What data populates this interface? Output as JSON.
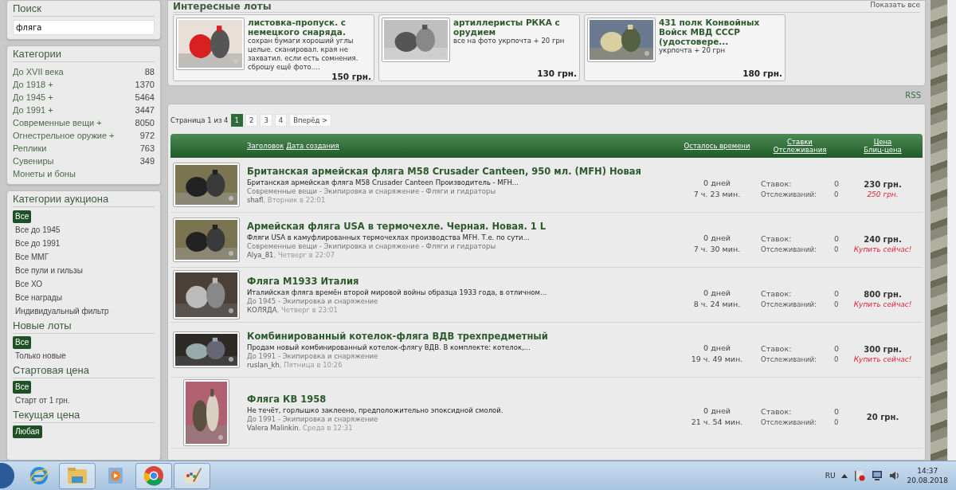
{
  "search": {
    "title": "Поиск",
    "value": "фляга"
  },
  "categories": {
    "title": "Категории",
    "items": [
      {
        "label": "До XVII века",
        "count": "88"
      },
      {
        "label": "До 1918 +",
        "count": "1370"
      },
      {
        "label": "До 1945 +",
        "count": "5464"
      },
      {
        "label": "До 1991 +",
        "count": "3447"
      },
      {
        "label": "Современные вещи +",
        "count": "8050"
      },
      {
        "label": "Огнестрельное оружие +",
        "count": "972"
      },
      {
        "label": "Реплики",
        "count": "763"
      },
      {
        "label": "Сувениры",
        "count": "349"
      },
      {
        "label": "Монеты и боны"
      }
    ]
  },
  "filters": [
    {
      "title": "Категории аукциона",
      "options": [
        {
          "label": "Все",
          "selected": true
        },
        {
          "label": "Все до 1945",
          "selected": false
        },
        {
          "label": "Все до 1991",
          "selected": false
        },
        {
          "label": "Все ММГ",
          "selected": false
        },
        {
          "label": "Все пули и гильзы",
          "selected": false
        },
        {
          "label": "Все ХО",
          "selected": false
        },
        {
          "label": "Все награды",
          "selected": false
        },
        {
          "label": "Индивидуальный фильтр",
          "selected": false
        }
      ]
    },
    {
      "title": "Новые лоты",
      "options": [
        {
          "label": "Все",
          "selected": true
        },
        {
          "label": "Только новые",
          "selected": false
        }
      ]
    },
    {
      "title": "Стартовая цена",
      "options": [
        {
          "label": "Все",
          "selected": true
        },
        {
          "label": "Старт от 1 грн.",
          "selected": false
        }
      ]
    },
    {
      "title": "Текущая цена",
      "options": [
        {
          "label": "Любая",
          "selected": true
        }
      ]
    }
  ],
  "interesting": {
    "title": "Интересные лоты",
    "show_all": "Показать все",
    "cards": [
      {
        "title": "листовка-пропуск. с немецкого снаряда.",
        "text": "сохран бумаги хороший углы целые. сканировал. края не захватил. если есть сомнения. сброшу ещё фото....",
        "price": "150 грн."
      },
      {
        "title": "артиллеристы РККА с орудием",
        "text": "все на фото укрпочта + 20 грн",
        "price": "130 грн."
      },
      {
        "title": "431 полк Конвойных Войск МВД СССР (удостовере...",
        "text": "укрпочта + 20 грн",
        "price": "180 грн."
      }
    ]
  },
  "rss": "RSS",
  "pagination": {
    "label": "Страница 1 из 4",
    "pages": [
      {
        "label": "1",
        "selected": true
      },
      {
        "label": "2",
        "selected": false
      },
      {
        "label": "3",
        "selected": false
      },
      {
        "label": "4",
        "selected": false
      }
    ],
    "next": "Вперёд >"
  },
  "columns": {
    "title": "Заголовок",
    "date": "Дата создания",
    "time_left": "Осталось времени",
    "bids": "Ставки",
    "watches": "Отслеживания",
    "price": "Цена",
    "blitz": "Блиц-цена"
  },
  "lots": [
    {
      "title": "Британская армейская фляга M58 Crusader Canteen, 950 мл. (MFH) Новая",
      "text": "Британская армейская фляга M58 Crusader Canteen Производитель - MFH...",
      "category": "Современные вещи - Экипировка и снаряжение - Фляги и гидраторы",
      "seller": "shafl",
      "date": ", Вторник в 22:01",
      "days": "0 дней",
      "time": "7 ч. 23 мин.",
      "bids_label": "Ставок:",
      "bids": "0",
      "watches_label": "Отслеживаний:",
      "watches": "0",
      "price": "230 грн.",
      "blitz": "250 грн."
    },
    {
      "title": "Армейская фляга USA в термочехле. Черная. Новая. 1 L",
      "text": "Фляги USA в камуфлированных термочехлах производства MFH. Т.е. по сути...",
      "category": "Современные вещи - Экипировка и снаряжение - Фляги и гидраторы",
      "seller": "Alya_81",
      "date": ", Четверг в 22:07",
      "days": "0 дней",
      "time": "7 ч. 30 мин.",
      "bids_label": "Ставок:",
      "bids": "0",
      "watches_label": "Отслеживаний:",
      "watches": "0",
      "price": "240 грн.",
      "blitz": "Купить сейчас!"
    },
    {
      "title": "Фляга M1933 Италия",
      "text": "Италийская фляга времён второй мировой войны образца 1933 года, в отличном...",
      "category": "До 1945 - Экипировка и снаряжение",
      "seller": "КОЛЯДА",
      "date": ", Четверг в 23:01",
      "days": "0 дней",
      "time": "8 ч. 24 мин.",
      "bids_label": "Ставок:",
      "bids": "0",
      "watches_label": "Отслеживаний:",
      "watches": "0",
      "price": "800 грн.",
      "blitz": "Купить сейчас!"
    },
    {
      "title": "Комбинированный котелок-фляга ВДВ трехпредметный",
      "text": "Продам новый комбинированный котелок-флягу ВДВ. В комплекте: котелок,...",
      "category": "До 1991 - Экипировка и снаряжение",
      "seller": "ruslan_kh",
      "date": ", Пятница в 10:26",
      "days": "0 дней",
      "time": "19 ч. 49 мин.",
      "bids_label": "Ставок:",
      "bids": "0",
      "watches_label": "Отслеживаний:",
      "watches": "0",
      "price": "300 грн.",
      "blitz": "Купить сейчас!"
    },
    {
      "title": "Фляга КВ 1958",
      "text": "Не течёт, горлышко заклеено, предположительно эпоксидной смолой.",
      "category": "До 1991 - Экипировка и снаряжение",
      "seller": "Valera Malinkin",
      "date": ", Среда в 12:31",
      "days": "0 дней",
      "time": "21 ч. 54 мин.",
      "bids_label": "Ставок:",
      "bids": "0",
      "watches_label": "Отслеживаний:",
      "watches": "0",
      "price": "20 грн."
    }
  ],
  "taskbar": {
    "language": "RU",
    "time": "14:37",
    "date": "20.08.2018"
  }
}
